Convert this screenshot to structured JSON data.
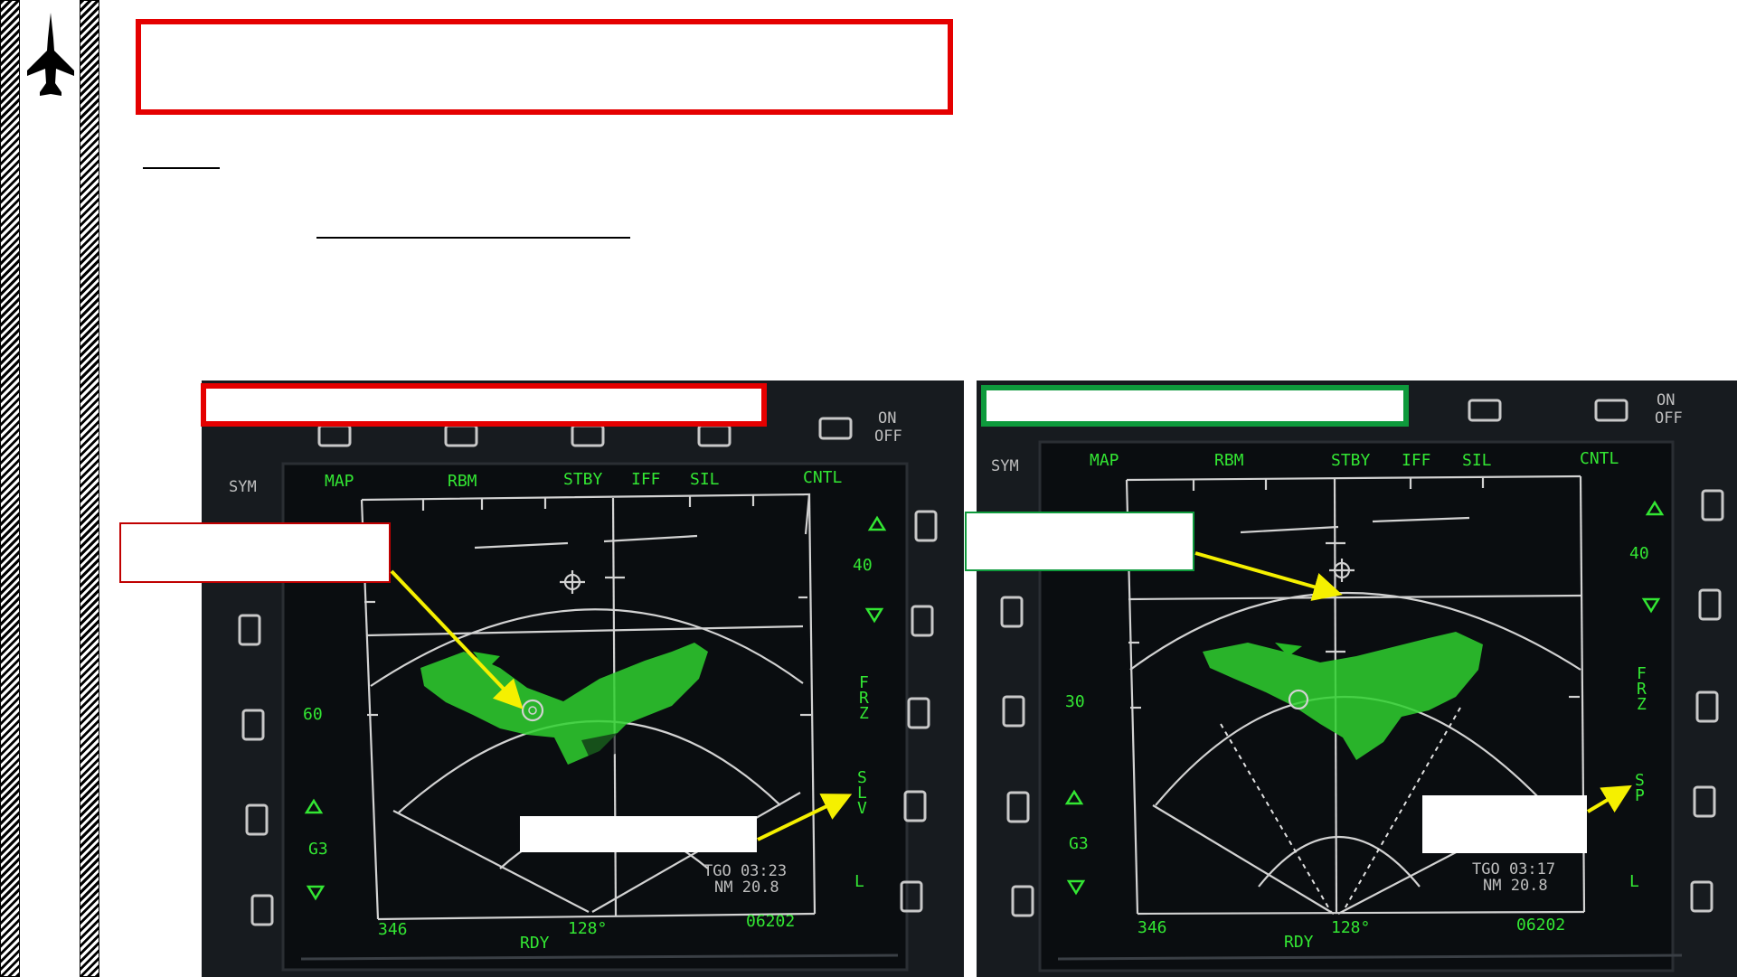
{
  "colors": {
    "accent_red": "#e50000",
    "accent_green": "#0e9a3c",
    "radar_green": "#33e633",
    "arrow_yellow": "#f5f000"
  },
  "left_display": {
    "top_labels": [
      "MAP",
      "RBM",
      "STBY",
      "IFF",
      "SIL",
      "CNTL"
    ],
    "sym": "SYM",
    "on": "ON",
    "off": "OFF",
    "range_value": "40",
    "elev_value": "60",
    "gain": "G3",
    "side_right": [
      "F",
      "R",
      "Z"
    ],
    "slv": [
      "S",
      "L",
      "V"
    ],
    "l_label": "L",
    "tgo": "TGO 03:23",
    "nm": "NM  20.8",
    "heading_left": "346",
    "rdy": "RDY",
    "heading_center": "128°",
    "right_code": "06202"
  },
  "right_display": {
    "top_labels": [
      "MAP",
      "RBM",
      "STBY",
      "IFF",
      "SIL",
      "CNTL"
    ],
    "sym": "SYM",
    "on": "ON",
    "off": "OFF",
    "range_value": "40",
    "elev_value": "30",
    "gain": "G3",
    "side_right": [
      "F",
      "R",
      "Z"
    ],
    "sp": [
      "S",
      "P"
    ],
    "l_label": "L",
    "tgo": "TGO 03:17",
    "nm": "NM  20.8",
    "heading_left": "346",
    "rdy": "RDY",
    "heading_center": "128°",
    "right_code": "06202"
  },
  "icons": {
    "logo": "jet-silhouette-icon"
  }
}
